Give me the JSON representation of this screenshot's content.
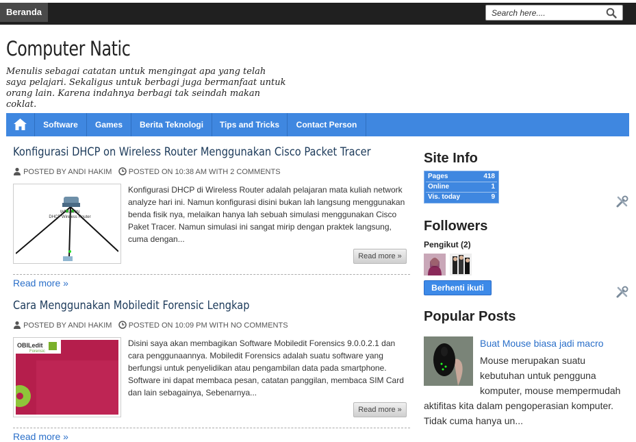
{
  "topbar": {
    "home_label": "Beranda",
    "search_placeholder": "Search here...."
  },
  "header": {
    "title": "Computer Natic",
    "tagline": "Menulis sebagai catatan untuk mengingat apa yang telah saya pelajari. Sekaligus untuk berbagi juga bermanfaat untuk orang lain. Karena indahnya berbagi tak seindah makan coklat."
  },
  "nav": {
    "items": [
      "Software",
      "Games",
      "Berita Teknologi",
      "Tips and Tricks",
      "Contact Person"
    ]
  },
  "posts": [
    {
      "title": "Konfigurasi DHCP on Wireless Router Menggunakan Cisco Packet Tracer",
      "author": "POSTED BY ANDI HAKIM",
      "posted": "POSTED ON 10:38 AM WITH 2 COMMENTS",
      "thumb_label_1": "WRS300N",
      "thumb_label_2": "DHCP Wireless Router",
      "snippet": "Konfigurasi DHCP di Wireless Router adalah pelajaran mata kuliah network analyze hari ini. Namun konfigurasi disini bukan lah langsung menggunakan benda fisik nya, melaikan hanya lah sebuah simulasi menggunakan Cisco Paket Tracer. Namun simulasi ini sangat mirip dengan praktek langsung, cuma dengan...",
      "read_more_button": "Read more »",
      "read_more_link": "Read more »"
    },
    {
      "title": "Cara Menggunakan Mobiledit Forensic Lengkap",
      "author": "POSTED BY ANDI HAKIM",
      "posted": "POSTED ON 10:09 PM WITH NO COMMENTS",
      "thumb_label_1": "OBILedit",
      "thumb_label_2": "Forensic",
      "snippet": "Disini saya akan membagikan Software Mobiledit Forensics 9.0.0.2.1 dan cara penggunaannya. Mobiledit Forensics  adalah suatu software yang berfungsi untuk penyelidikan atau pengambilan data pada smartphone. Software ini dapat membaca pesan, catatan panggilan, membaca SIM Card dan lain sebagainya, Sebenarnya...",
      "read_more_button": "Read more »",
      "read_more_link": "Read more »"
    }
  ],
  "sidebar": {
    "site_info": {
      "title": "Site Info",
      "rows": [
        {
          "label": "Pages",
          "value": "418"
        },
        {
          "label": "Online",
          "value": "1"
        },
        {
          "label": "Vis. today",
          "value": "9"
        }
      ]
    },
    "followers": {
      "title": "Followers",
      "label": "Pengikut (2)",
      "unfollow_button": "Berhenti ikuti"
    },
    "popular": {
      "title": "Popular Posts",
      "post_title": "Buat Mouse biasa jadi macro",
      "lines": [
        "Mouse merupakan suatu",
        "kebutuhan untuk pengguna",
        "komputer, mouse mempermudah",
        "aktifitas kita dalam pengoperasian komputer.",
        "Tidak cuma hanya un..."
      ]
    }
  },
  "colors": {
    "nav": "#3f87e0",
    "link": "#2a6fc9",
    "topbar": "#202020"
  }
}
